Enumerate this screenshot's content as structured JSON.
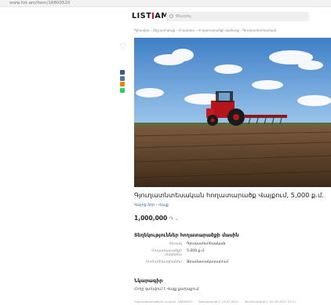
{
  "browser": {
    "url": "www.list.am/item/16800520"
  },
  "header": {
    "logo_left": "LIST",
    "logo_right": "AM",
    "search_placeholder": "Փնտրել"
  },
  "breadcrumb": "Գլխավոր › Անշարժ գույք › Հողամաս › Հողատարածքի վաճառք › Գյուղատնտեսական",
  "listing": {
    "title": "Գյուղատնտեսական հողատարածք Վայքում, 5,000 ք.մ.",
    "location": "Վայոց ձոր › Վայք",
    "price": "1,000,000",
    "currency": "֏"
  },
  "properties": {
    "section_title": "Տեղեկություններ հողատարածքի մասին",
    "rows": [
      {
        "key": "Տեսակ",
        "value": "Գյուղատնտեսական"
      },
      {
        "key": "Հողատարածքի մակերես",
        "value": "5,000 ք.մ."
      },
      {
        "key": "Կոմունիկացիաներ",
        "value": "Ջրամատակարարում"
      }
    ]
  },
  "description": {
    "section_title": "Նկարագիր",
    "text": "Հողը գտնվում է Վայք քաղաքում"
  },
  "footer": {
    "ad_number": "Հայտարարության համար՝ 16800520",
    "posted": "Տեղադրված է՝ 19.07.2021",
    "updated": "Թարմացված է՝ 20.09.2022 10:01"
  },
  "colors": {
    "brand_red": "#c8102e",
    "facebook": "#3b5998",
    "vk": "#4a76a8",
    "ok": "#ee8208",
    "whatsapp": "#25d366",
    "link_blue": "#3b6db5"
  },
  "icons": {
    "favorite": "heart-icon",
    "search": "search-icon",
    "share": [
      "facebook-icon",
      "vk-icon",
      "odnoklassniki-icon",
      "whatsapp-icon"
    ],
    "price_dropdown": "chevron-down-icon"
  }
}
